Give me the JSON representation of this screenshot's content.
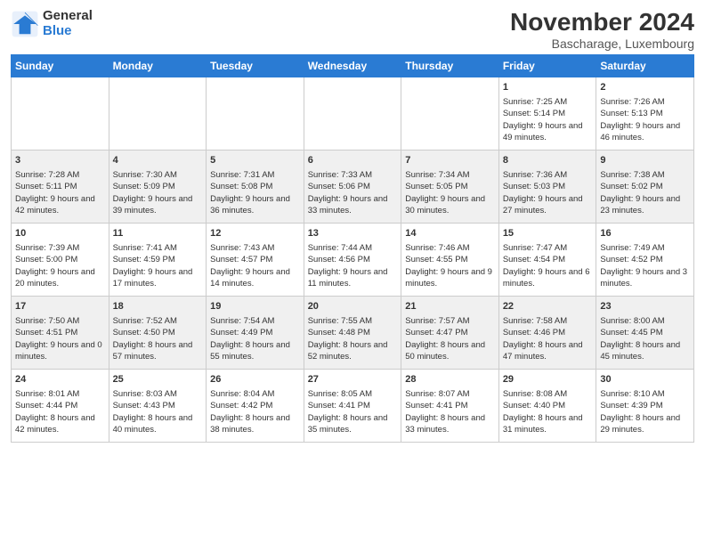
{
  "logo": {
    "general": "General",
    "blue": "Blue"
  },
  "title": "November 2024",
  "subtitle": "Bascharage, Luxembourg",
  "days_of_week": [
    "Sunday",
    "Monday",
    "Tuesday",
    "Wednesday",
    "Thursday",
    "Friday",
    "Saturday"
  ],
  "weeks": [
    [
      {
        "day": "",
        "info": ""
      },
      {
        "day": "",
        "info": ""
      },
      {
        "day": "",
        "info": ""
      },
      {
        "day": "",
        "info": ""
      },
      {
        "day": "",
        "info": ""
      },
      {
        "day": "1",
        "info": "Sunrise: 7:25 AM\nSunset: 5:14 PM\nDaylight: 9 hours and 49 minutes."
      },
      {
        "day": "2",
        "info": "Sunrise: 7:26 AM\nSunset: 5:13 PM\nDaylight: 9 hours and 46 minutes."
      }
    ],
    [
      {
        "day": "3",
        "info": "Sunrise: 7:28 AM\nSunset: 5:11 PM\nDaylight: 9 hours and 42 minutes."
      },
      {
        "day": "4",
        "info": "Sunrise: 7:30 AM\nSunset: 5:09 PM\nDaylight: 9 hours and 39 minutes."
      },
      {
        "day": "5",
        "info": "Sunrise: 7:31 AM\nSunset: 5:08 PM\nDaylight: 9 hours and 36 minutes."
      },
      {
        "day": "6",
        "info": "Sunrise: 7:33 AM\nSunset: 5:06 PM\nDaylight: 9 hours and 33 minutes."
      },
      {
        "day": "7",
        "info": "Sunrise: 7:34 AM\nSunset: 5:05 PM\nDaylight: 9 hours and 30 minutes."
      },
      {
        "day": "8",
        "info": "Sunrise: 7:36 AM\nSunset: 5:03 PM\nDaylight: 9 hours and 27 minutes."
      },
      {
        "day": "9",
        "info": "Sunrise: 7:38 AM\nSunset: 5:02 PM\nDaylight: 9 hours and 23 minutes."
      }
    ],
    [
      {
        "day": "10",
        "info": "Sunrise: 7:39 AM\nSunset: 5:00 PM\nDaylight: 9 hours and 20 minutes."
      },
      {
        "day": "11",
        "info": "Sunrise: 7:41 AM\nSunset: 4:59 PM\nDaylight: 9 hours and 17 minutes."
      },
      {
        "day": "12",
        "info": "Sunrise: 7:43 AM\nSunset: 4:57 PM\nDaylight: 9 hours and 14 minutes."
      },
      {
        "day": "13",
        "info": "Sunrise: 7:44 AM\nSunset: 4:56 PM\nDaylight: 9 hours and 11 minutes."
      },
      {
        "day": "14",
        "info": "Sunrise: 7:46 AM\nSunset: 4:55 PM\nDaylight: 9 hours and 9 minutes."
      },
      {
        "day": "15",
        "info": "Sunrise: 7:47 AM\nSunset: 4:54 PM\nDaylight: 9 hours and 6 minutes."
      },
      {
        "day": "16",
        "info": "Sunrise: 7:49 AM\nSunset: 4:52 PM\nDaylight: 9 hours and 3 minutes."
      }
    ],
    [
      {
        "day": "17",
        "info": "Sunrise: 7:50 AM\nSunset: 4:51 PM\nDaylight: 9 hours and 0 minutes."
      },
      {
        "day": "18",
        "info": "Sunrise: 7:52 AM\nSunset: 4:50 PM\nDaylight: 8 hours and 57 minutes."
      },
      {
        "day": "19",
        "info": "Sunrise: 7:54 AM\nSunset: 4:49 PM\nDaylight: 8 hours and 55 minutes."
      },
      {
        "day": "20",
        "info": "Sunrise: 7:55 AM\nSunset: 4:48 PM\nDaylight: 8 hours and 52 minutes."
      },
      {
        "day": "21",
        "info": "Sunrise: 7:57 AM\nSunset: 4:47 PM\nDaylight: 8 hours and 50 minutes."
      },
      {
        "day": "22",
        "info": "Sunrise: 7:58 AM\nSunset: 4:46 PM\nDaylight: 8 hours and 47 minutes."
      },
      {
        "day": "23",
        "info": "Sunrise: 8:00 AM\nSunset: 4:45 PM\nDaylight: 8 hours and 45 minutes."
      }
    ],
    [
      {
        "day": "24",
        "info": "Sunrise: 8:01 AM\nSunset: 4:44 PM\nDaylight: 8 hours and 42 minutes."
      },
      {
        "day": "25",
        "info": "Sunrise: 8:03 AM\nSunset: 4:43 PM\nDaylight: 8 hours and 40 minutes."
      },
      {
        "day": "26",
        "info": "Sunrise: 8:04 AM\nSunset: 4:42 PM\nDaylight: 8 hours and 38 minutes."
      },
      {
        "day": "27",
        "info": "Sunrise: 8:05 AM\nSunset: 4:41 PM\nDaylight: 8 hours and 35 minutes."
      },
      {
        "day": "28",
        "info": "Sunrise: 8:07 AM\nSunset: 4:41 PM\nDaylight: 8 hours and 33 minutes."
      },
      {
        "day": "29",
        "info": "Sunrise: 8:08 AM\nSunset: 4:40 PM\nDaylight: 8 hours and 31 minutes."
      },
      {
        "day": "30",
        "info": "Sunrise: 8:10 AM\nSunset: 4:39 PM\nDaylight: 8 hours and 29 minutes."
      }
    ]
  ]
}
